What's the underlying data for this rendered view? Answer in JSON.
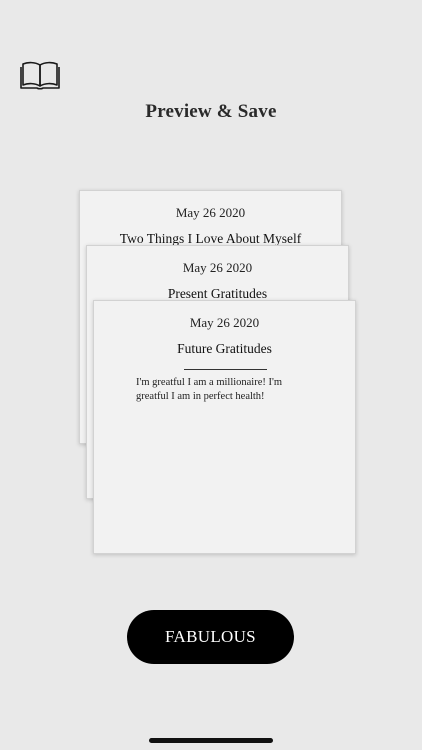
{
  "header": {
    "icon": "book-icon",
    "title": "Preview & Save"
  },
  "cards": [
    {
      "date": "May 26 2020",
      "heading": "Two Things I Love About Myself",
      "body": ""
    },
    {
      "date": "May 26 2020",
      "heading": "Present Gratitudes",
      "body": ""
    },
    {
      "date": "May 26 2020",
      "heading": "Future Gratitudes",
      "body": "I'm greatful I am a millionaire! I'm greatful I am in perfect health!"
    }
  ],
  "action": {
    "label": "FABULOUS"
  },
  "colors": {
    "background": "#e9e9e9",
    "card": "#f2f2f2",
    "button": "#000000",
    "button_text": "#ffffff"
  }
}
